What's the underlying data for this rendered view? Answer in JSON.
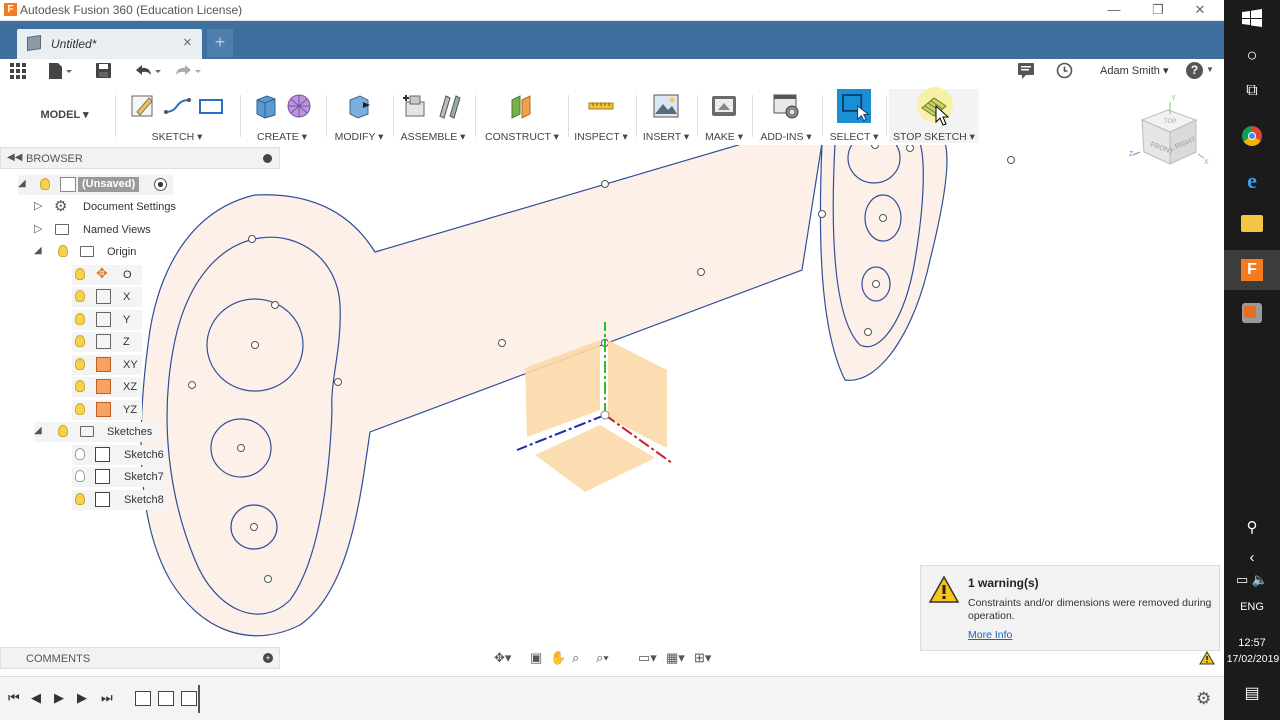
{
  "window": {
    "title": "Autodesk Fusion 360 (Education License)",
    "minimize": "—",
    "restore": "❐",
    "close": "✕"
  },
  "tabs": {
    "document_tab": "Untitled*",
    "close": "×",
    "new_tab": "+"
  },
  "quick_access": {
    "user": "Adam Smith ▾",
    "help": "?"
  },
  "toolbar": {
    "workspace": "MODEL ▾",
    "groups": [
      {
        "label": "SKETCH ▾"
      },
      {
        "label": "CREATE ▾"
      },
      {
        "label": "MODIFY ▾"
      },
      {
        "label": "ASSEMBLE ▾"
      },
      {
        "label": "CONSTRUCT ▾"
      },
      {
        "label": "INSPECT ▾"
      },
      {
        "label": "INSERT ▾"
      },
      {
        "label": "MAKE ▾"
      },
      {
        "label": "ADD-INS ▾"
      },
      {
        "label": "SELECT ▾"
      },
      {
        "label": "STOP SKETCH ▾"
      }
    ]
  },
  "browser": {
    "header": "BROWSER",
    "root": "(Unsaved)",
    "items": [
      {
        "label": "Document Settings"
      },
      {
        "label": "Named Views"
      },
      {
        "label": "Origin"
      },
      {
        "label": "O"
      },
      {
        "label": "X"
      },
      {
        "label": "Y"
      },
      {
        "label": "Z"
      },
      {
        "label": "XY"
      },
      {
        "label": "XZ"
      },
      {
        "label": "YZ"
      },
      {
        "label": "Sketches"
      },
      {
        "label": "Sketch6"
      },
      {
        "label": "Sketch7"
      },
      {
        "label": "Sketch8"
      }
    ]
  },
  "viewcube": {
    "front": "FRONT",
    "right": "RIGHT",
    "top": "TOP",
    "axis_x": "X",
    "axis_y": "Y",
    "axis_z": "Z"
  },
  "warning": {
    "title": "1 warning(s)",
    "message": "Constraints and/or dimensions were removed during operation.",
    "link": "More Info"
  },
  "comments": {
    "header": "COMMENTS"
  },
  "taskbar": {
    "language": "ENG",
    "time": "12:57",
    "date": "17/02/2019"
  },
  "colors": {
    "tab_bar": "#3f6f9e",
    "select_button": "#1a8fd6",
    "sketch_profile": "#fdf0e8",
    "sketch_line": "#2f4f98",
    "link": "#1b64c8"
  }
}
